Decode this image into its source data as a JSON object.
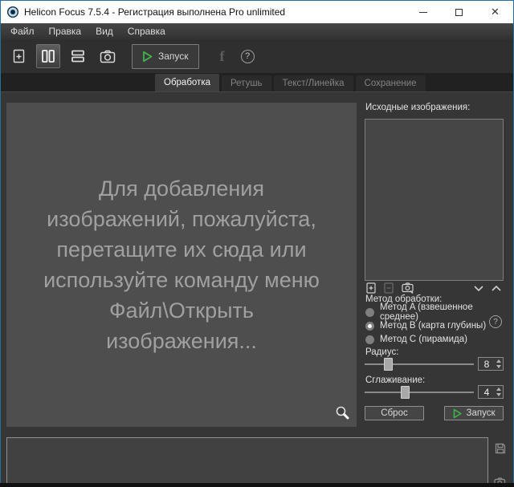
{
  "window": {
    "title": "Helicon Focus 7.5.4 - Регистрация выполнена Pro unlimited",
    "controls": {
      "minimize_icon": "minimize-line",
      "maximize_icon": "maximize-square",
      "close_glyph": "✕"
    }
  },
  "menu": {
    "items": [
      "Файл",
      "Правка",
      "Вид",
      "Справка"
    ]
  },
  "toolbar": {
    "icons": [
      "add-images-icon",
      "vertical-split-icon",
      "horizontal-split-icon",
      "camera-icon"
    ],
    "active_icon": "vertical-split-icon",
    "run_label": "Запуск",
    "facebook_glyph": "f",
    "help_glyph": "?"
  },
  "tabs": [
    {
      "label": "Обработка",
      "active": true
    },
    {
      "label": "Ретушь",
      "active": false
    },
    {
      "label": "Текст/Линейка",
      "active": false
    },
    {
      "label": "Сохранение",
      "active": false
    }
  ],
  "dropzone": {
    "lines": [
      "Для добавления",
      "изображений, пожалуйста,",
      "перетащите их сюда или",
      "используйте команду меню",
      "Файл\\Открыть",
      "изображения..."
    ],
    "zoom_icon": "magnifier-icon"
  },
  "sidebar": {
    "source_title": "Исходные изображения:",
    "list_icons": [
      "add-image-icon",
      "remove-image-icon",
      "capture-camera-icon",
      "move-down-icon",
      "move-up-icon"
    ],
    "method": {
      "title": "Метод обработки:",
      "help_glyph": "?",
      "options": [
        {
          "label": "Метод A (взвешенное среднее)",
          "selected": false
        },
        {
          "label": "Метод B (карта глубины)",
          "selected": true
        },
        {
          "label": "Метод C (пирамида)",
          "selected": false
        }
      ]
    },
    "radius": {
      "label": "Радиус:",
      "value": "8"
    },
    "smoothing": {
      "label": "Сглаживание:",
      "value": "4"
    },
    "buttons": {
      "reset_label": "Сброс",
      "run_label": "Запуск"
    }
  },
  "bottom": {
    "icons": [
      "save-icon",
      "camera-small-icon"
    ]
  },
  "colors": {
    "accent_green": "#3fb549",
    "window_border_blue": "#2c6c9c",
    "titlebar": "#ffffff",
    "panel_bg": "#4e4e4e",
    "ui_bg": "#363636"
  }
}
